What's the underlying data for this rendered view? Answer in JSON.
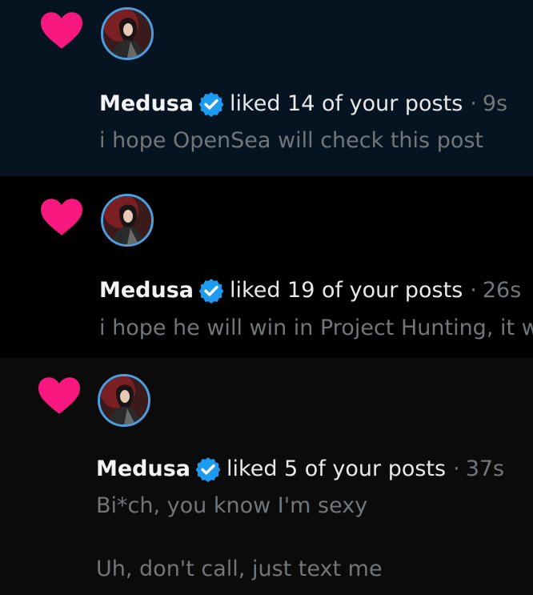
{
  "colors": {
    "heart": "#f91880",
    "verified": "#1d9bf0",
    "row1_bg": "#061422",
    "row2_bg": "#000000",
    "row3_bg": "#0b0b0b",
    "secondary_text": "#71767b",
    "primary_text": "#e7e9ea"
  },
  "notifications": [
    {
      "icon": "heart-icon",
      "user_name": "Medusa",
      "verified_icon": "verified-badge-icon",
      "action": "liked 14 of your posts",
      "separator": "·",
      "time": "9s",
      "lines": [
        "i hope OpenSea will check this post"
      ]
    },
    {
      "icon": "heart-icon",
      "user_name": "Medusa",
      "verified_icon": "verified-badge-icon",
      "action": "liked 19 of your posts",
      "separator": "·",
      "time": "26s",
      "lines": [
        "i hope he will win in Project Hunting, it w"
      ]
    },
    {
      "icon": "heart-icon",
      "user_name": "Medusa",
      "verified_icon": "verified-badge-icon",
      "action": "liked 5 of your posts",
      "separator": "·",
      "time": "37s",
      "lines": [
        "Bi*ch, you know I'm sexy",
        "Uh, don't call, just text me"
      ]
    }
  ]
}
